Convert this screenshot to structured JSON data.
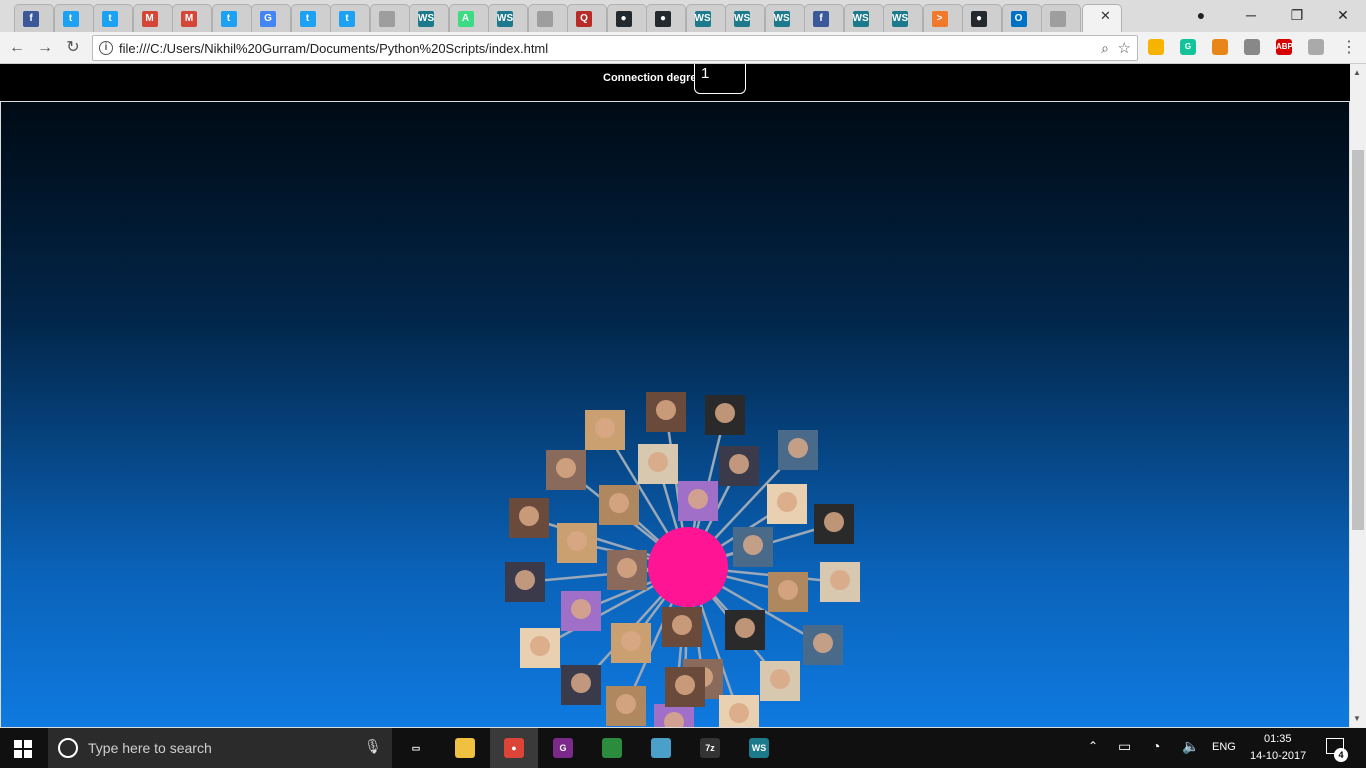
{
  "browser": {
    "url": "file:///C:/Users/Nikhil%20Gurram/Documents/Python%20Scripts/index.html",
    "tabs": [
      {
        "icon": "facebook-icon",
        "color": "#3b5998",
        "glyph": "f"
      },
      {
        "icon": "twitter-icon",
        "color": "#1da1f2",
        "glyph": "t"
      },
      {
        "icon": "twitter-icon",
        "color": "#1da1f2",
        "glyph": "t"
      },
      {
        "icon": "gmail-icon",
        "color": "#d44638",
        "glyph": "M"
      },
      {
        "icon": "gmail-icon",
        "color": "#d44638",
        "glyph": "M"
      },
      {
        "icon": "twitter-icon",
        "color": "#1da1f2",
        "glyph": "t"
      },
      {
        "icon": "google-icon",
        "color": "#4285f4",
        "glyph": "G"
      },
      {
        "icon": "twitter-icon",
        "color": "#1da1f2",
        "glyph": "t"
      },
      {
        "icon": "twitter-icon",
        "color": "#1da1f2",
        "glyph": "t"
      },
      {
        "icon": "page-icon",
        "color": "#9e9e9e",
        "glyph": ""
      },
      {
        "icon": "webstorm-icon",
        "color": "#1c7a8c",
        "glyph": "WS"
      },
      {
        "icon": "android-icon",
        "color": "#3ddc84",
        "glyph": "A"
      },
      {
        "icon": "webstorm-icon",
        "color": "#1c7a8c",
        "glyph": "WS"
      },
      {
        "icon": "page-icon",
        "color": "#9e9e9e",
        "glyph": ""
      },
      {
        "icon": "quora-icon",
        "color": "#b92b27",
        "glyph": "Q"
      },
      {
        "icon": "github-icon",
        "color": "#24292e",
        "glyph": "●"
      },
      {
        "icon": "github-icon",
        "color": "#24292e",
        "glyph": "●"
      },
      {
        "icon": "webstorm-icon",
        "color": "#1c7a8c",
        "glyph": "WS"
      },
      {
        "icon": "webstorm-icon",
        "color": "#1c7a8c",
        "glyph": "WS"
      },
      {
        "icon": "webstorm-icon",
        "color": "#1c7a8c",
        "glyph": "WS"
      },
      {
        "icon": "facebook-icon",
        "color": "#3b5998",
        "glyph": "f"
      },
      {
        "icon": "webstorm-icon",
        "color": "#1c7a8c",
        "glyph": "WS"
      },
      {
        "icon": "webstorm-icon",
        "color": "#1c7a8c",
        "glyph": "WS"
      },
      {
        "icon": "hackerrank-icon",
        "color": "#f0792b",
        "glyph": ">"
      },
      {
        "icon": "github-icon",
        "color": "#24292e",
        "glyph": "●"
      },
      {
        "icon": "outlook-icon",
        "color": "#0072c6",
        "glyph": "O"
      },
      {
        "icon": "page-icon",
        "color": "#9e9e9e",
        "glyph": ""
      }
    ],
    "extensions": [
      {
        "icon": "keep-icon",
        "color": "#f6b400",
        "glyph": ""
      },
      {
        "icon": "grammarly-icon",
        "color": "#15c39a",
        "glyph": "G"
      },
      {
        "icon": "extension-icon",
        "color": "#e8861a",
        "glyph": ""
      },
      {
        "icon": "extension-icon",
        "color": "#888888",
        "glyph": ""
      },
      {
        "icon": "adblock-icon",
        "color": "#d60000",
        "glyph": "ABP"
      },
      {
        "icon": "extension-icon",
        "color": "#aaaaaa",
        "glyph": ""
      }
    ]
  },
  "page": {
    "degree_label": "Connection degree",
    "degree_value": "1",
    "graph": {
      "center_color": "#ff1493",
      "link_color": "#9aa8b8",
      "node_count": 31
    }
  },
  "taskbar": {
    "search_placeholder": "Type here to search",
    "language": "ENG",
    "time": "01:35",
    "date": "14-10-2017",
    "notification_count": "4",
    "apps": [
      {
        "icon": "task-view-icon",
        "color": "#101010",
        "glyph": "▭"
      },
      {
        "icon": "file-explorer-icon",
        "color": "#f0c040",
        "glyph": ""
      },
      {
        "icon": "chrome-icon",
        "color": "#db4437",
        "glyph": "●"
      },
      {
        "icon": "pdf-app-icon",
        "color": "#7b2a8c",
        "glyph": "G"
      },
      {
        "icon": "internet-download-icon",
        "color": "#2a8c3c",
        "glyph": ""
      },
      {
        "icon": "notes-app-icon",
        "color": "#4aa0c8",
        "glyph": ""
      },
      {
        "icon": "7zip-icon",
        "color": "#333333",
        "glyph": "7z"
      },
      {
        "icon": "webstorm-icon",
        "color": "#1c7a8c",
        "glyph": "WS"
      }
    ]
  }
}
